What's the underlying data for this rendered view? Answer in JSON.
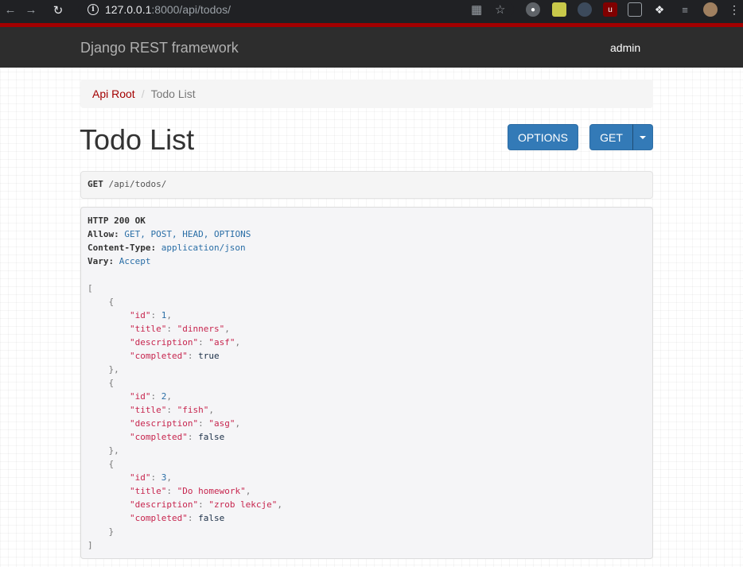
{
  "browser": {
    "url_host": "127.0.0.1",
    "url_rest": ":8000/api/todos/"
  },
  "navbar": {
    "brand": "Django REST framework",
    "user": "admin"
  },
  "breadcrumb": {
    "root": "Api Root",
    "current": "Todo List"
  },
  "page": {
    "title": "Todo List"
  },
  "buttons": {
    "options": "OPTIONS",
    "get": "GET"
  },
  "request": {
    "method": "GET",
    "path": "/api/todos/"
  },
  "response": {
    "status": "HTTP 200 OK",
    "headers": [
      {
        "key": "Allow:",
        "value": "GET, POST, HEAD, OPTIONS"
      },
      {
        "key": "Content-Type:",
        "value": "application/json"
      },
      {
        "key": "Vary:",
        "value": "Accept"
      }
    ],
    "items": [
      {
        "id": "1",
        "title": "\"dinners\"",
        "description": "\"asf\"",
        "completed": "true"
      },
      {
        "id": "2",
        "title": "\"fish\"",
        "description": "\"asg\"",
        "completed": "false"
      },
      {
        "id": "3",
        "title": "\"Do homework\"",
        "description": "\"zrob lekcje\"",
        "completed": "false"
      }
    ],
    "keys": {
      "id": "\"id\"",
      "title": "\"title\"",
      "description": "\"description\"",
      "completed": "\"completed\""
    }
  },
  "colors": {
    "accent": "#a30000",
    "button": "#337ab7",
    "navbar": "#2d2d2d"
  }
}
